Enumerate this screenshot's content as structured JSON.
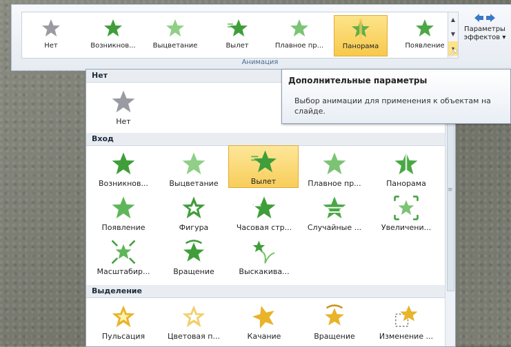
{
  "colors": {
    "accent_green": "#3f9e3a",
    "selection": "#f8cd5a",
    "gold": "#e9b32a",
    "gray": "#9a9aa2"
  },
  "ribbon": {
    "gallery": [
      {
        "label": "Нет",
        "icon": "star-gray-icon"
      },
      {
        "label": "Возникнов...",
        "icon": "star-green-icon"
      },
      {
        "label": "Выцветание",
        "icon": "star-fade-icon"
      },
      {
        "label": "Вылет",
        "icon": "star-fly-icon"
      },
      {
        "label": "Плавное пр...",
        "icon": "star-float-icon"
      },
      {
        "label": "Панорама",
        "icon": "star-split-icon",
        "selected": true
      },
      {
        "label": "Появление",
        "icon": "star-green-icon"
      }
    ],
    "effects_button": {
      "line1": "Параметры",
      "line2": "эффектов ▾"
    },
    "group_label": "Анимация"
  },
  "dropdown": {
    "sections": [
      {
        "title": "Нет",
        "items": [
          {
            "label": "Нет"
          }
        ]
      },
      {
        "title": "Вход",
        "items": [
          {
            "label": "Возникнов..."
          },
          {
            "label": "Выцветание"
          },
          {
            "label": "Вылет",
            "selected": true
          },
          {
            "label": "Плавное пр..."
          },
          {
            "label": "Панорама"
          },
          {
            "label": "Появление"
          },
          {
            "label": "Фигура"
          },
          {
            "label": "Часовая стр..."
          },
          {
            "label": "Случайные ..."
          },
          {
            "label": "Увеличени..."
          },
          {
            "label": "Масштабир..."
          },
          {
            "label": "Вращение"
          },
          {
            "label": "Выскакива..."
          }
        ]
      },
      {
        "title": "Выделение",
        "items": [
          {
            "label": "Пульсация"
          },
          {
            "label": "Цветовая п..."
          },
          {
            "label": "Качание"
          },
          {
            "label": "Вращение"
          },
          {
            "label": "Изменение ..."
          }
        ]
      }
    ]
  },
  "tooltip": {
    "title": "Дополнительные параметры",
    "description": "Выбор анимации для применения к объектам на слайде."
  }
}
